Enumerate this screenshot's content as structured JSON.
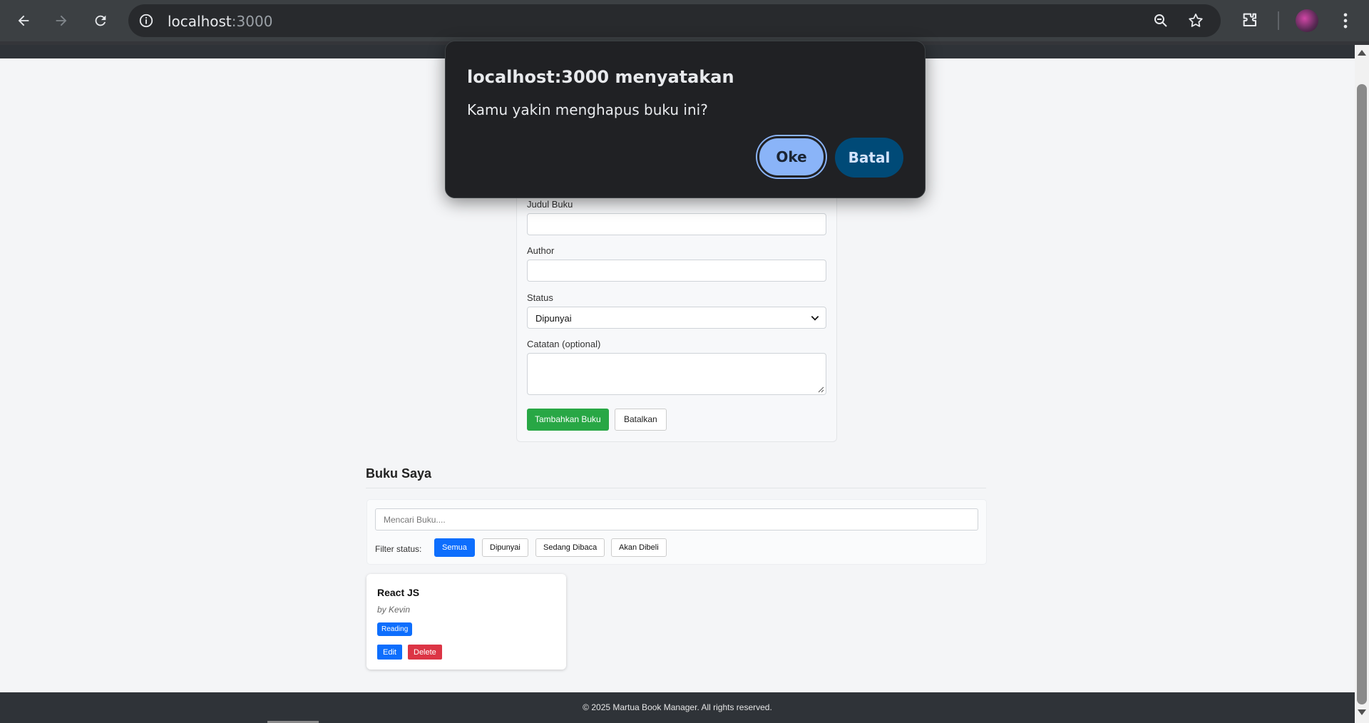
{
  "browser": {
    "url_host": "localhost",
    "url_port": ":3000"
  },
  "form": {
    "title_label": "Judul Buku",
    "author_label": "Author",
    "status_label": "Status",
    "status_value": "Dipunyai",
    "notes_label": "Catatan (optional)",
    "submit_label": "Tambahkan Buku",
    "cancel_label": "Batalkan"
  },
  "books": {
    "section_title": "Buku Saya",
    "search_placeholder": "Mencari Buku....",
    "filter_label": "Filter status:",
    "filters": [
      "Semua",
      "Dipunyai",
      "Sedang Dibaca",
      "Akan Dibeli"
    ],
    "active_filter": "Semua",
    "items": [
      {
        "title": "React JS",
        "author": "by Kevin",
        "status": "Reading",
        "edit_label": "Edit",
        "delete_label": "Delete"
      }
    ]
  },
  "footer": {
    "text": "© 2025 Martua Book Manager. All rights reserved."
  },
  "dialog": {
    "title": "localhost:3000 menyatakan",
    "message": "Kamu yakin menghapus buku ini?",
    "ok_label": "Oke",
    "cancel_label": "Batal"
  },
  "colors": {
    "primary": "#0d6efd",
    "success": "#28a745",
    "danger": "#dc3545",
    "dialog_ok": "#8ab4f8",
    "dialog_cancel": "#004a77"
  }
}
